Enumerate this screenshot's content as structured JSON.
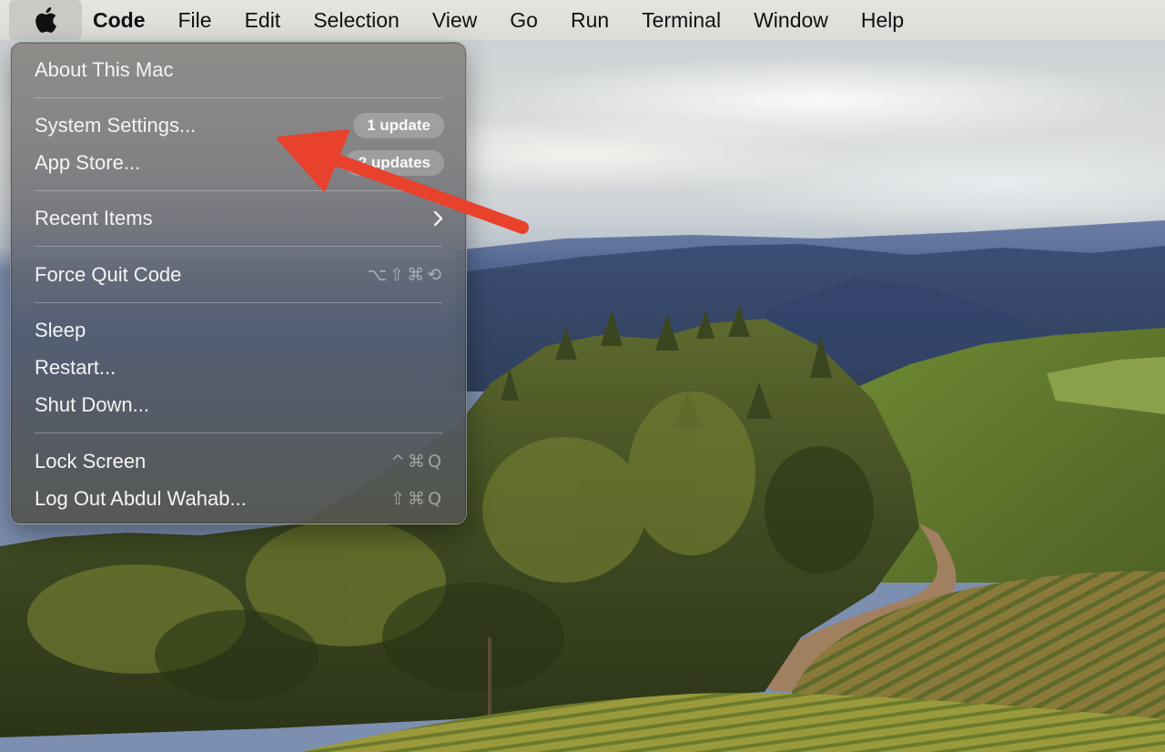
{
  "menubar": {
    "apple_icon": "apple-logo-icon",
    "app_name": "Code",
    "menus": [
      "File",
      "Edit",
      "Selection",
      "View",
      "Go",
      "Run",
      "Terminal",
      "Window",
      "Help"
    ]
  },
  "apple_menu": {
    "about": "About This Mac",
    "system_settings": {
      "label": "System Settings...",
      "badge": "1 update"
    },
    "app_store": {
      "label": "App Store...",
      "badge": "2 updates"
    },
    "recent_items": {
      "label": "Recent Items",
      "submenu_icon": "chevron-right-icon"
    },
    "force_quit": {
      "label": "Force Quit Code",
      "shortcut": "⌥⇧⌘⟲"
    },
    "sleep": "Sleep",
    "restart": "Restart...",
    "shut_down": "Shut Down...",
    "lock_screen": {
      "label": "Lock Screen",
      "shortcut": "^⌘Q"
    },
    "log_out": {
      "label": "Log Out Abdul Wahab...",
      "shortcut": "⇧⌘Q"
    }
  },
  "annotation": {
    "arrow_color": "#e8412c"
  }
}
